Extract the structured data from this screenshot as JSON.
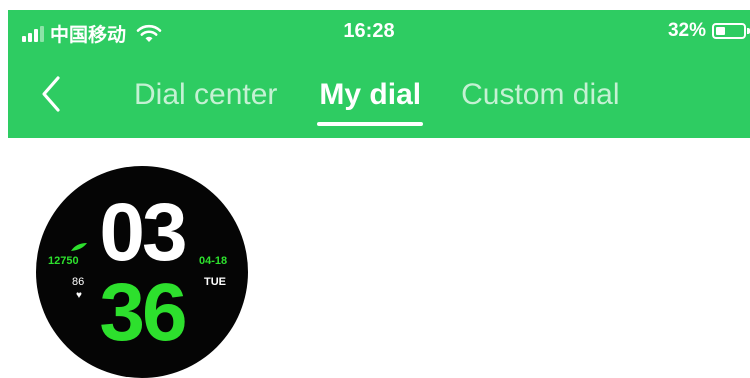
{
  "status_bar": {
    "carrier": "中国移动",
    "time": "16:28",
    "battery": "32%"
  },
  "nav": {
    "tabs": [
      {
        "label": "Dial center",
        "active": false
      },
      {
        "label": "My dial",
        "active": true
      },
      {
        "label": "Custom dial",
        "active": false
      }
    ]
  },
  "dial": {
    "hour": "03",
    "minute": "36",
    "steps": "12750",
    "heart_rate": "86",
    "date": "04-18",
    "weekday": "TUE"
  },
  "colors": {
    "header_bg": "#2ecc62",
    "dial_accent": "#2de02d",
    "dial_bg": "#050505"
  }
}
